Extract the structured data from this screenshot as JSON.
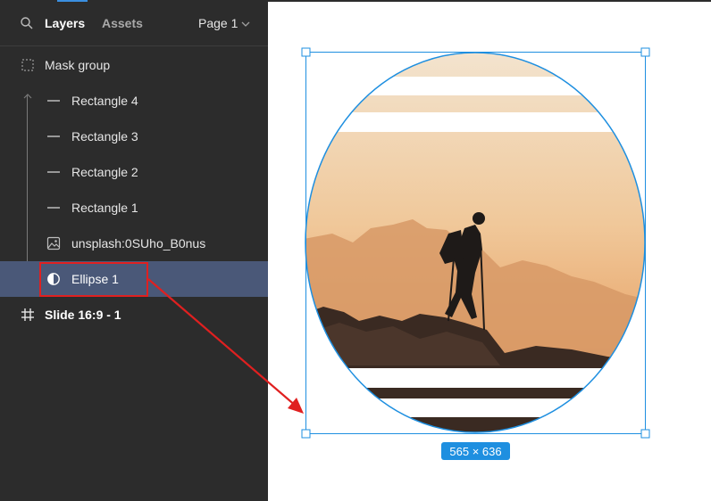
{
  "panel": {
    "tabs": {
      "layers": "Layers",
      "assets": "Assets",
      "page": "Page 1"
    },
    "layers": [
      {
        "name": "Mask group",
        "icon": "mask-group-icon"
      },
      {
        "name": "Rectangle 4",
        "icon": "rectangle-line-icon"
      },
      {
        "name": "Rectangle 3",
        "icon": "rectangle-line-icon"
      },
      {
        "name": "Rectangle 2",
        "icon": "rectangle-line-icon"
      },
      {
        "name": "Rectangle 1",
        "icon": "rectangle-line-icon"
      },
      {
        "name": "unsplash:0SUho_B0nus",
        "icon": "image-icon"
      },
      {
        "name": "Ellipse 1",
        "icon": "mask-icon",
        "selected": true
      },
      {
        "name": "Slide 16:9 - 1",
        "icon": "frame-icon"
      }
    ]
  },
  "canvas": {
    "dimensions": "565 × 636"
  },
  "colors": {
    "panel_bg": "#2c2c2c",
    "selection": "#4a5878",
    "accent_blue": "#1e8fe0",
    "annotation_red": "#e02020"
  }
}
